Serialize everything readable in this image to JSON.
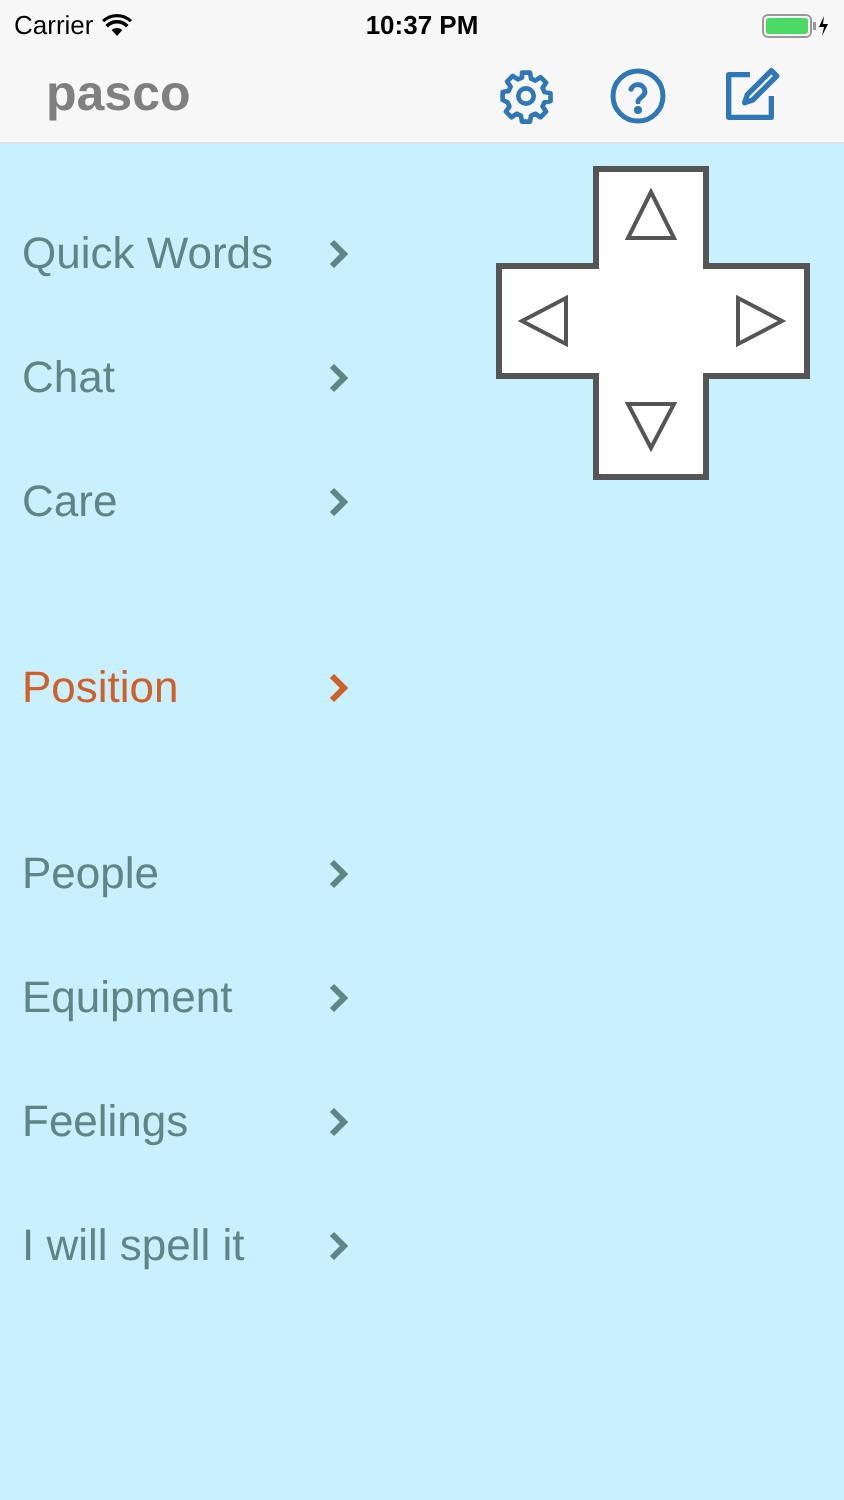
{
  "status_bar": {
    "carrier": "Carrier",
    "time": "10:37 PM"
  },
  "nav_bar": {
    "title": "pasco"
  },
  "menu": [
    {
      "label": "Quick Words",
      "selected": false
    },
    {
      "label": "Chat",
      "selected": false
    },
    {
      "label": "Care",
      "selected": false
    },
    {
      "label": "Position",
      "selected": true
    },
    {
      "label": "People",
      "selected": false
    },
    {
      "label": "Equipment",
      "selected": false
    },
    {
      "label": "Feelings",
      "selected": false
    },
    {
      "label": "I will spell it",
      "selected": false
    }
  ]
}
